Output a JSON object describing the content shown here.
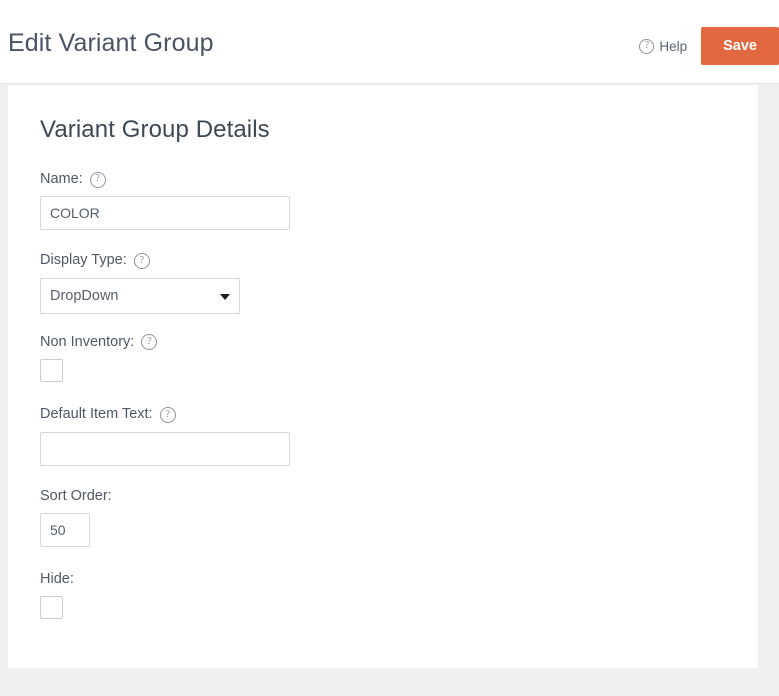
{
  "header": {
    "title": "Edit Variant Group",
    "help_label": "Help",
    "help_icon": "question-circle-icon",
    "save_label": "Save",
    "accent_color": "#e2683f"
  },
  "card": {
    "section_title": "Variant Group Details",
    "fields": [
      {
        "id": "name",
        "label": "Name:",
        "has_help": true,
        "type": "text",
        "value": "COLOR",
        "placeholder": ""
      },
      {
        "id": "display_type",
        "label": "Display Type:",
        "has_help": true,
        "type": "select",
        "value": "DropDown",
        "options": [
          "DropDown"
        ]
      },
      {
        "id": "non_inventory",
        "label": "Non Inventory:",
        "has_help": true,
        "type": "checkbox",
        "checked": false
      },
      {
        "id": "default_item_text",
        "label": "Default Item Text:",
        "has_help": true,
        "type": "text",
        "value": "",
        "placeholder": ""
      },
      {
        "id": "sort_order",
        "label": "Sort Order:",
        "has_help": false,
        "type": "text",
        "value": "50",
        "placeholder": ""
      },
      {
        "id": "hide",
        "label": "Hide:",
        "has_help": false,
        "type": "checkbox",
        "checked": false
      }
    ]
  },
  "icons": {
    "help": "?",
    "dropdown_arrow": "chevron-down-icon"
  }
}
